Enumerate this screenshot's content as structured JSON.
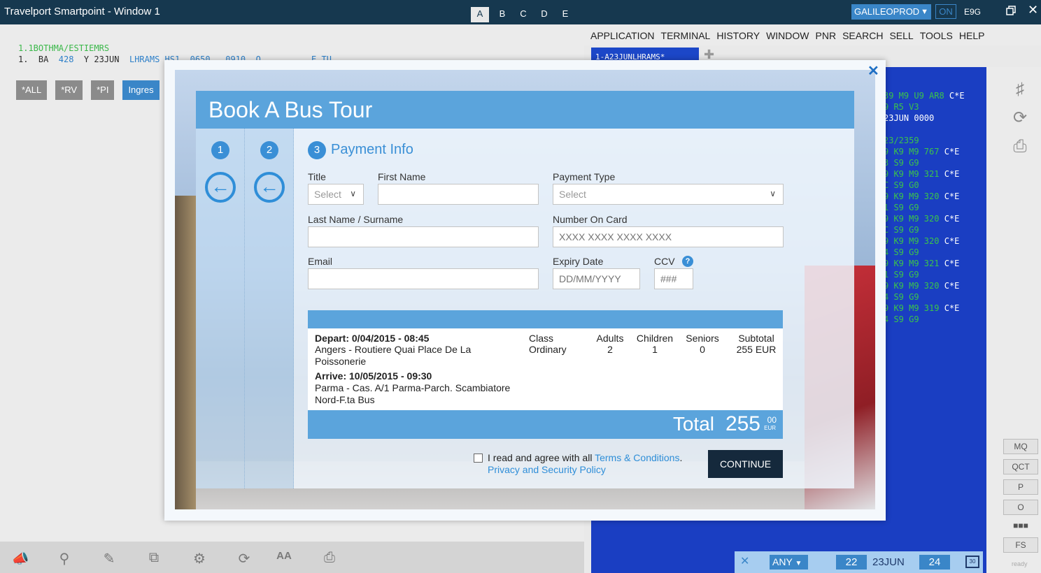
{
  "window": {
    "title": "Travelport Smartpoint - Window 1",
    "tabs": [
      "A",
      "B",
      "C",
      "D",
      "E"
    ],
    "host": "GALILEOPROD",
    "status": "ON",
    "pcc": "E9G"
  },
  "left_terminal": {
    "line1": "1.1BOTHMA/ESTIEMRS",
    "line2_prefix": "1.  BA  ",
    "line2_flight": "428",
    "line2_rest": "  Y 23JUN  ",
    "line2_route": "LHRAMS HS1  0650   0910  O          E TU",
    "quick_buttons": [
      "*ALL",
      "*RV",
      "*PI",
      "Ingres"
    ]
  },
  "right_terminal": {
    "menu": [
      "APPLICATION",
      "TERMINAL",
      "HISTORY",
      "WINDOW",
      "PNR",
      "SEARCH",
      "SELL",
      "TOOLS",
      "HELP"
    ],
    "tab_label": "1-A23JUNLHRAMS*",
    "lines": [
      {
        "g": "39 M9 U9 AR8 ",
        "w": "C*E"
      },
      {
        "g": "9 R5 V3",
        "w": ""
      },
      {
        "g": "",
        "w": "23JUN 0000"
      },
      {
        "g": "",
        "w": ""
      },
      {
        "g": "23/2359",
        "w": ""
      },
      {
        "g": "9 K9 M9 767 ",
        "w": "C*E"
      },
      {
        "g": "3 S9 G9",
        "w": ""
      },
      {
        "g": "9 K9 M9 321 ",
        "w": "C*E"
      },
      {
        "g": "C S9 G0",
        "w": ""
      },
      {
        "g": "9 K9 M9 320 ",
        "w": "C*E"
      },
      {
        "g": "1 S9 G9",
        "w": ""
      },
      {
        "g": "9 K9 M9 320 ",
        "w": "C*E"
      },
      {
        "g": "C S9 G9",
        "w": ""
      },
      {
        "g": "9 K9 M9 320 ",
        "w": "C*E"
      },
      {
        "g": "4 S9 G9",
        "w": ""
      },
      {
        "g": "9 K9 M9 321 ",
        "w": "C*E"
      },
      {
        "g": "1 S9 G9",
        "w": ""
      },
      {
        "g": "9 K9 M9 320 ",
        "w": "C*E"
      },
      {
        "g": "4 S9 G9",
        "w": ""
      },
      {
        "g": "9 K9 M9 319 ",
        "w": "C*E"
      },
      {
        "g": "4 S9 G9",
        "w": ""
      }
    ],
    "side_buttons": [
      "MQ",
      "QCT",
      "P",
      "O",
      "■■■",
      "FS"
    ],
    "status": "ready",
    "date_nav": {
      "filter": "ANY",
      "prev": "22",
      "current": "23JUN",
      "next": "24",
      "calendar": "30"
    }
  },
  "modal": {
    "title": "Book A Bus Tour",
    "steps": [
      "1",
      "2",
      "3"
    ],
    "section_title": "Payment Info",
    "form": {
      "title_label": "Title",
      "title_placeholder": "Select",
      "first_name_label": "First Name",
      "last_name_label": "Last Name / Surname",
      "email_label": "Email",
      "payment_type_label": "Payment Type",
      "payment_type_placeholder": "Select",
      "card_number_label": "Number On Card",
      "card_number_placeholder": "XXXX XXXX XXXX XXXX",
      "expiry_label": "Expiry Date",
      "expiry_placeholder": "DD/MM/YYYY",
      "ccv_label": "CCV",
      "ccv_placeholder": "###"
    },
    "summary": {
      "depart_heading": "Depart: 0/04/2015 - 08:45",
      "depart_line1": "Angers - Routiere Quai Place De La",
      "depart_line2": "Poissonerie",
      "arrive_heading": "Arrive: 10/05/2015 - 09:30",
      "arrive_line1": "Parma - Cas. A/1 Parma-Parch. Scambiatore",
      "arrive_line2": "Nord-F.ta Bus",
      "class_label": "Class",
      "class_value": "Ordinary",
      "adults_label": "Adults",
      "adults_value": "2",
      "children_label": "Children",
      "children_value": "1",
      "seniors_label": "Seniors",
      "seniors_value": "0",
      "subtotal_label": "Subtotal",
      "subtotal_value": "255 EUR"
    },
    "total": {
      "label": "Total",
      "integer": "255",
      "cents": "00",
      "currency": "EUR"
    },
    "agree_text": "I read and agree with all ",
    "terms_link": "Terms & Conditions",
    "agree_end": ".",
    "privacy_link": "Privacy and Security Policy",
    "continue_label": "CONTINUE"
  },
  "colors": {
    "titlebar": "#16384f",
    "accent": "#5ba4dc",
    "terminal_bg": "#1a3ec2",
    "terminal_green": "#3bc44a",
    "continue_button": "#15293c"
  }
}
